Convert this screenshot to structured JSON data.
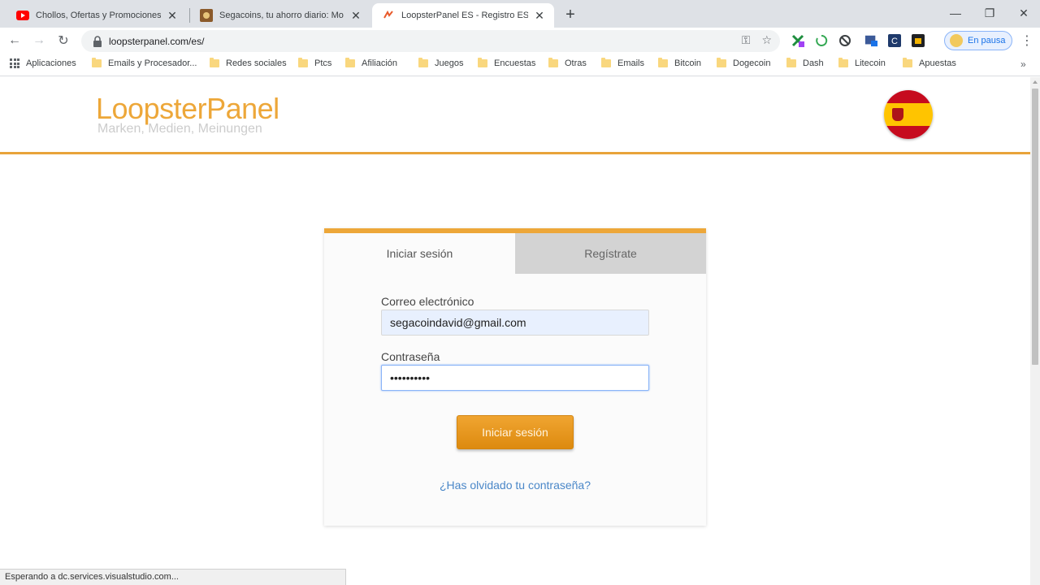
{
  "browser": {
    "tabs": [
      {
        "title": "Chollos, Ofertas y Promociones",
        "icon": "youtube-icon"
      },
      {
        "title": "Segacoins, tu ahorro diario: Mo",
        "icon": "site-favicon"
      },
      {
        "title": "LoopsterPanel ES - Registro ES",
        "icon": "loopster-favicon",
        "active": true
      }
    ],
    "new_tab": "+",
    "url": "loopsterpanel.com/es/",
    "profile_label": "En pausa",
    "bookmarks": [
      "Aplicaciones",
      "Emails y Procesador...",
      "Redes sociales",
      "Ptcs",
      "Afiliación",
      "Juegos",
      "Encuestas",
      "Otras",
      "Emails",
      "Bitcoin",
      "Dogecoin",
      "Dash",
      "Litecoin",
      "Apuestas"
    ],
    "status_text": "Esperando a dc.services.visualstudio.com..."
  },
  "site": {
    "logo": "LoopsterPanel",
    "tagline": "Marken, Medien, Meinungen",
    "accent_color": "#eda739"
  },
  "login": {
    "tab_login": "Iniciar sesión",
    "tab_register": "Regístrate",
    "email_label": "Correo electrónico",
    "email_value": "segacoindavid@gmail.com",
    "password_label": "Contraseña",
    "password_value": "••••••••••",
    "submit_label": "Iniciar sesión",
    "forgot_link": "¿Has olvidado tu contraseña?"
  }
}
